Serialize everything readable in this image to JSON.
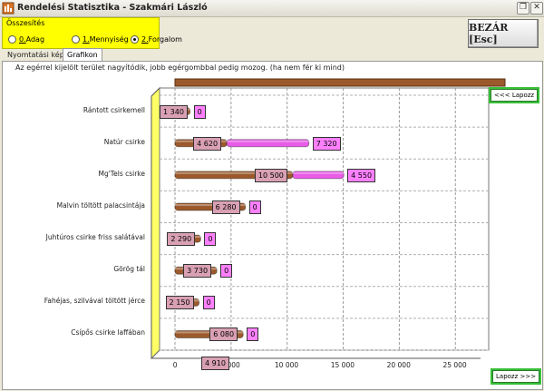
{
  "window": {
    "title": "Rendelési Statisztika - Szakmári László"
  },
  "summary": {
    "title": "Összesítés",
    "options": [
      {
        "key": "0.",
        "label": " Adag",
        "checked": false
      },
      {
        "key": "1.",
        "label": " Mennyiség",
        "checked": false
      },
      {
        "key": "2.",
        "label": " Forgalom",
        "checked": true
      }
    ]
  },
  "close_button": {
    "label": "BEZÁR [Esc]"
  },
  "tabs": [
    {
      "label": "Nyomtatási kép",
      "active": false
    },
    {
      "label": "Grafikon",
      "active": true
    }
  ],
  "hint": "Az egérrel kijelölt terület nagyítódik, jobb egérgombbal pedig mozog. (ha nem fér ki mind)",
  "paging": {
    "prev": "<<< Lapozz",
    "next": "Lapozz >>>"
  },
  "colors": {
    "series_a": "#9c5a2c",
    "series_b": "#e85ce8",
    "label_a": "#d9a0b4",
    "label_b": "#ff80ff",
    "wall": "#ffff66",
    "pager": "#38c038"
  },
  "chart_data": {
    "type": "bar",
    "orientation": "horizontal",
    "stacked": true,
    "categories": [
      "Rántott csirkemell",
      "Natúr csirke",
      "Mg'Tels csirke",
      "Malvin töltött palacsintája",
      "Juhtúros csirke friss salátával",
      "Görög tál",
      "Fahéjas, szilvával töltött jérce",
      "Csípős csirke laffában"
    ],
    "series": [
      {
        "values": [
          1340,
          4620,
          10500,
          6280,
          2290,
          3730,
          2150,
          6080
        ],
        "labels": [
          "1 340",
          "4 620",
          "10 500",
          "6 280",
          "2 290",
          "3 730",
          "2 150",
          "6 080"
        ]
      },
      {
        "values": [
          0,
          7320,
          4550,
          0,
          0,
          0,
          0,
          0
        ],
        "labels": [
          "0",
          "7 320",
          "4 550",
          "0",
          "0",
          "0",
          "0",
          "0"
        ]
      }
    ],
    "partial_bar": {
      "value_label": "4 910"
    },
    "xlim": [
      0,
      27000
    ],
    "xticks": [
      0,
      5000,
      10000,
      15000,
      20000,
      25000
    ],
    "xtick_labels": [
      "0",
      "5 000",
      "10 000",
      "15 000",
      "20 000",
      "25 000"
    ],
    "grid": true
  }
}
